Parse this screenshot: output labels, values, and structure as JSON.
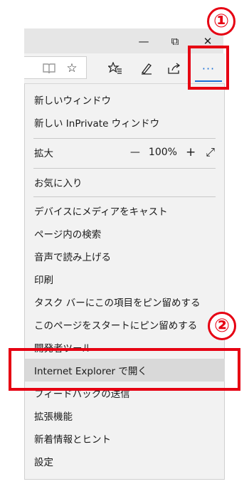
{
  "window": {
    "minimize_icon": "—",
    "restore_icon": "⧉",
    "close_icon": "✕"
  },
  "toolbar": {
    "reading_view_icon": "📖",
    "favorite_icon": "☆",
    "favorites_hub_icon": "☆≡",
    "notes_icon": "✎",
    "share_icon": "⇪",
    "more_icon": "···"
  },
  "menu": {
    "new_window": "新しいウィンドウ",
    "new_inprivate": "新しい InPrivate ウィンドウ",
    "zoom_label": "拡大",
    "zoom_out": "—",
    "zoom_value": "100%",
    "zoom_in": "+",
    "fullscreen": "⤢",
    "favorites": "お気に入り",
    "cast": "デバイスにメディアをキャスト",
    "find": "ページ内の検索",
    "read_aloud": "音声で読み上げる",
    "print": "印刷",
    "pin_taskbar": "タスク バーにこの項目をピン留めする",
    "pin_start": "このページをスタートにピン留めする",
    "devtools": "開発者ツール",
    "open_ie": "Internet Explorer で開く",
    "feedback": "フィードバックの送信",
    "extensions": "拡張機能",
    "whats_new": "新着情報とヒント",
    "settings": "設定"
  },
  "annotations": {
    "step1": "①",
    "step2": "②",
    "accent_color": "#e60012"
  }
}
